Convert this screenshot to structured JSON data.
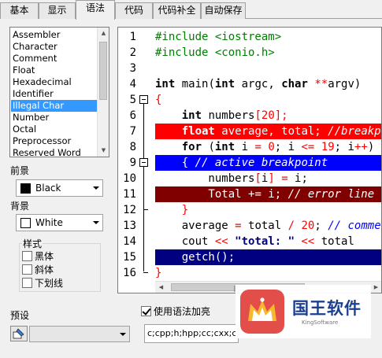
{
  "tabs": [
    {
      "label": "基本",
      "active": false
    },
    {
      "label": "显示",
      "active": false
    },
    {
      "label": "语法",
      "active": true
    },
    {
      "label": "代码",
      "active": false
    },
    {
      "label": "代码补全",
      "active": false
    },
    {
      "label": "自动保存",
      "active": false
    }
  ],
  "categories": {
    "items": [
      "Assembler",
      "Character",
      "Comment",
      "Float",
      "Hexadecimal",
      "Identifier",
      "Illegal Char",
      "Number",
      "Octal",
      "Preprocessor",
      "Reserved Word"
    ],
    "selected": "Illegal Char"
  },
  "foreground": {
    "label": "前景",
    "value": "Black",
    "swatch": "#000000"
  },
  "background": {
    "label": "背景",
    "value": "White",
    "swatch": "#ffffff"
  },
  "style": {
    "label": "样式",
    "bold": {
      "label": "黑体",
      "checked": false
    },
    "italic": {
      "label": "斜体",
      "checked": false
    },
    "underline": {
      "label": "下划线",
      "checked": false
    }
  },
  "editor": {
    "line_numbers": [
      "1",
      "2",
      "3",
      "4",
      "5",
      "6",
      "7",
      "8",
      "9",
      "10",
      "11",
      "12",
      "13",
      "14",
      "15",
      "16"
    ],
    "colors": {
      "error_line": "#ff0000",
      "active_breakpoint": "#0000ff",
      "illegal_char_line": "#800000",
      "selected_line": "#000080"
    }
  },
  "preset": {
    "label": "预设",
    "value": ""
  },
  "syntax_highlight": {
    "label": "使用语法加亮",
    "checked": true
  },
  "extensions": {
    "value": "c;cpp;h;hpp;cc;cxx;cp"
  },
  "watermark": {
    "title": "国王软件",
    "subtitle": "KingSoftware"
  }
}
